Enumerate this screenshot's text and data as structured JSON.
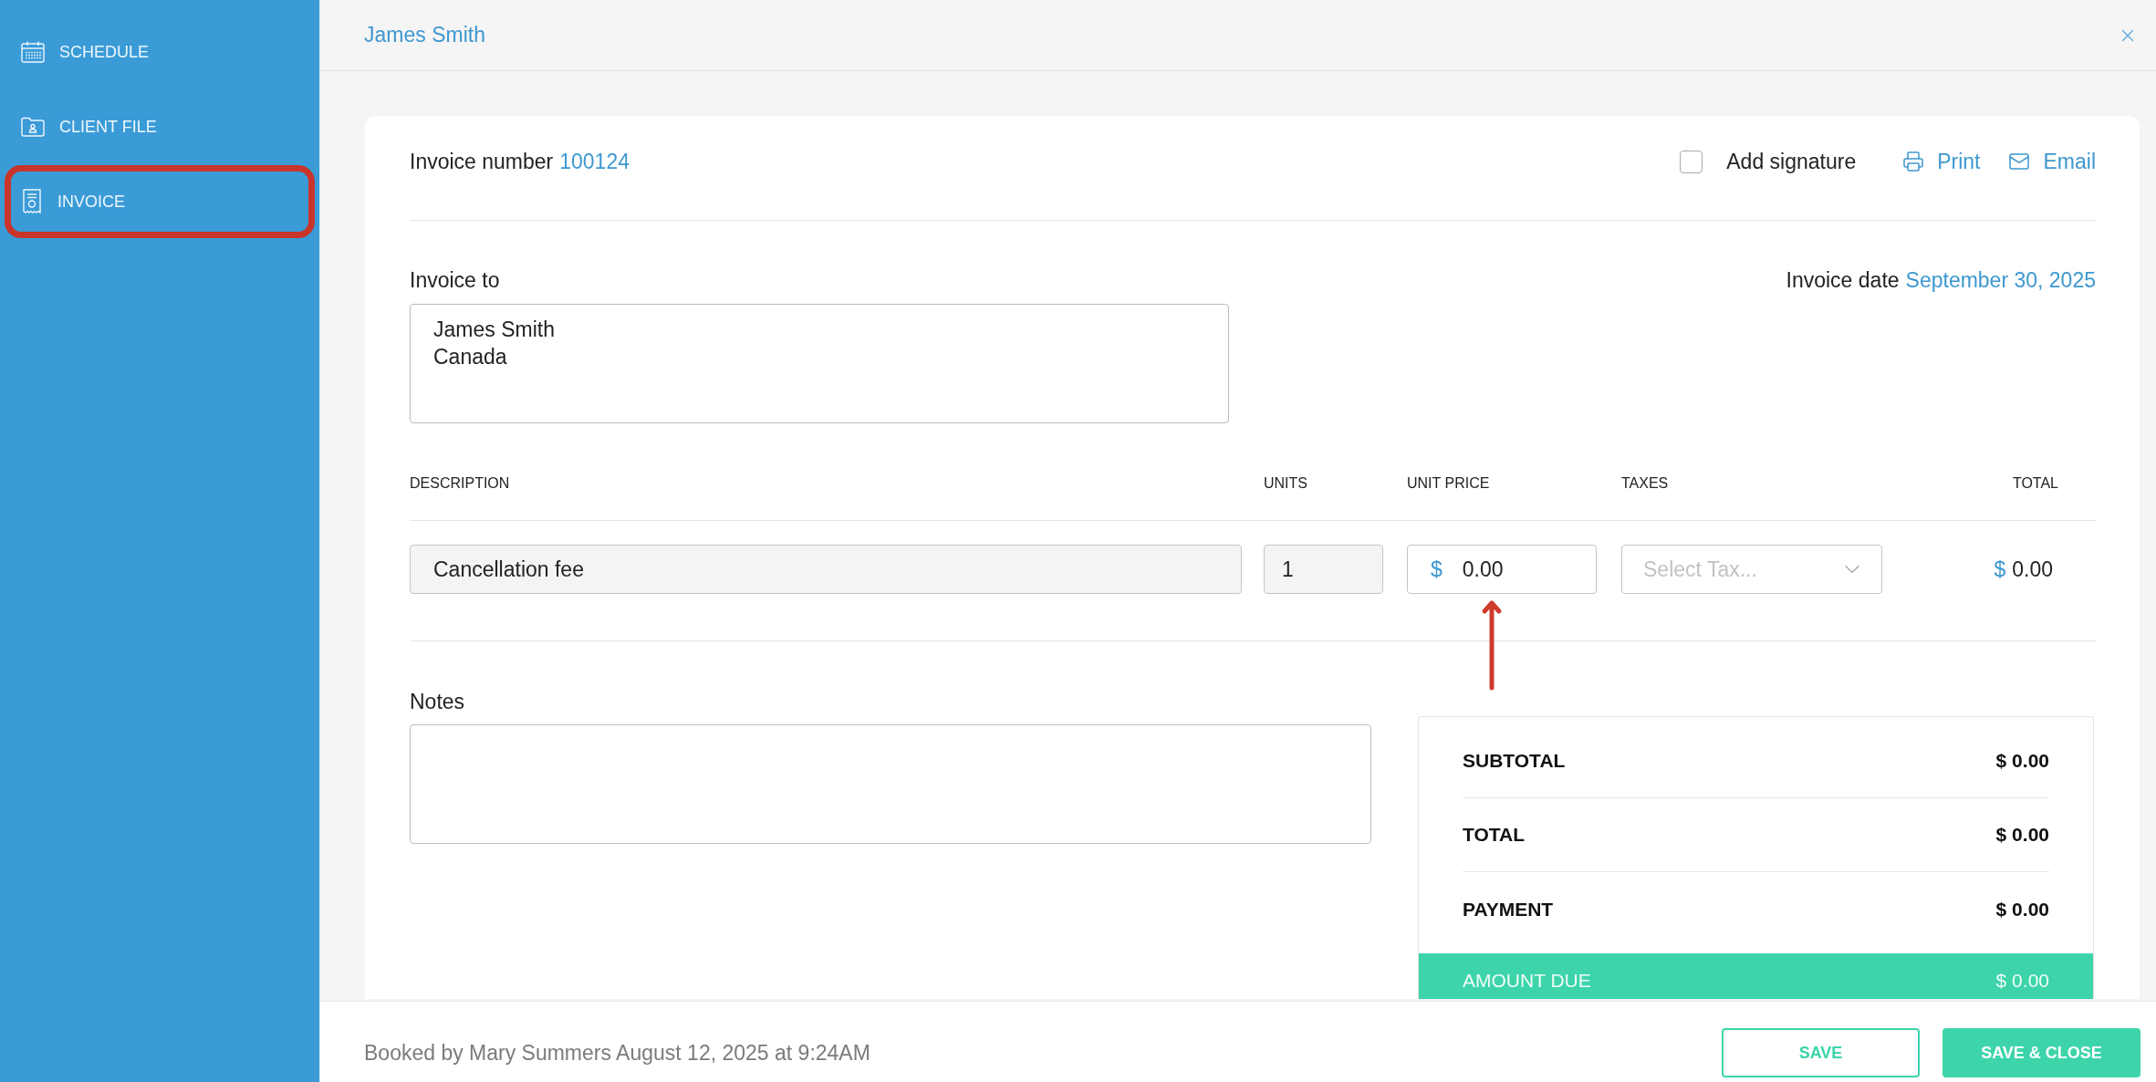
{
  "sidebar": {
    "items": [
      {
        "label": "SCHEDULE",
        "outlined": false
      },
      {
        "label": "CLIENT FILE",
        "outlined": false
      },
      {
        "label": "INVOICE",
        "outlined": true
      }
    ]
  },
  "header": {
    "title": "James Smith"
  },
  "invoice": {
    "number_label": "Invoice number",
    "number": "100124",
    "signature": {
      "label": "Add signature",
      "checked": false
    },
    "actions": [
      {
        "label": "Print"
      },
      {
        "label": "Email"
      }
    ],
    "to_label": "Invoice to",
    "address": "James Smith\nCanada",
    "date_label": "Invoice date",
    "date": "September 30, 2025"
  },
  "line_items": {
    "columns": [
      "DESCRIPTION",
      "UNITS",
      "UNIT PRICE",
      "TAXES",
      "TOTAL"
    ],
    "rows": [
      {
        "description": "Cancellation fee",
        "units": "1",
        "price_currency": "$",
        "unit_price": "0.00",
        "tax_placeholder": "Select Tax...",
        "total_currency": "$",
        "total": "0.00",
        "price_arrow": true
      }
    ]
  },
  "notes": {
    "label": "Notes"
  },
  "summary": {
    "rows": [
      {
        "kind": "line",
        "label": "SUBTOTAL",
        "value": "$ 0.00"
      },
      {
        "kind": "line",
        "label": "TOTAL",
        "value": "$ 0.00"
      },
      {
        "kind": "line",
        "label": "PAYMENT",
        "value": "$ 0.00"
      },
      {
        "kind": "due",
        "label": "AMOUNT DUE",
        "value": "$ 0.00"
      }
    ]
  },
  "footer": {
    "booked": "Booked by Mary Summers August 12, 2025 at 9:24AM",
    "buttons": [
      {
        "kind": "outline",
        "label": "SAVE"
      },
      {
        "kind": "primary",
        "label": "SAVE & CLOSE"
      }
    ]
  }
}
